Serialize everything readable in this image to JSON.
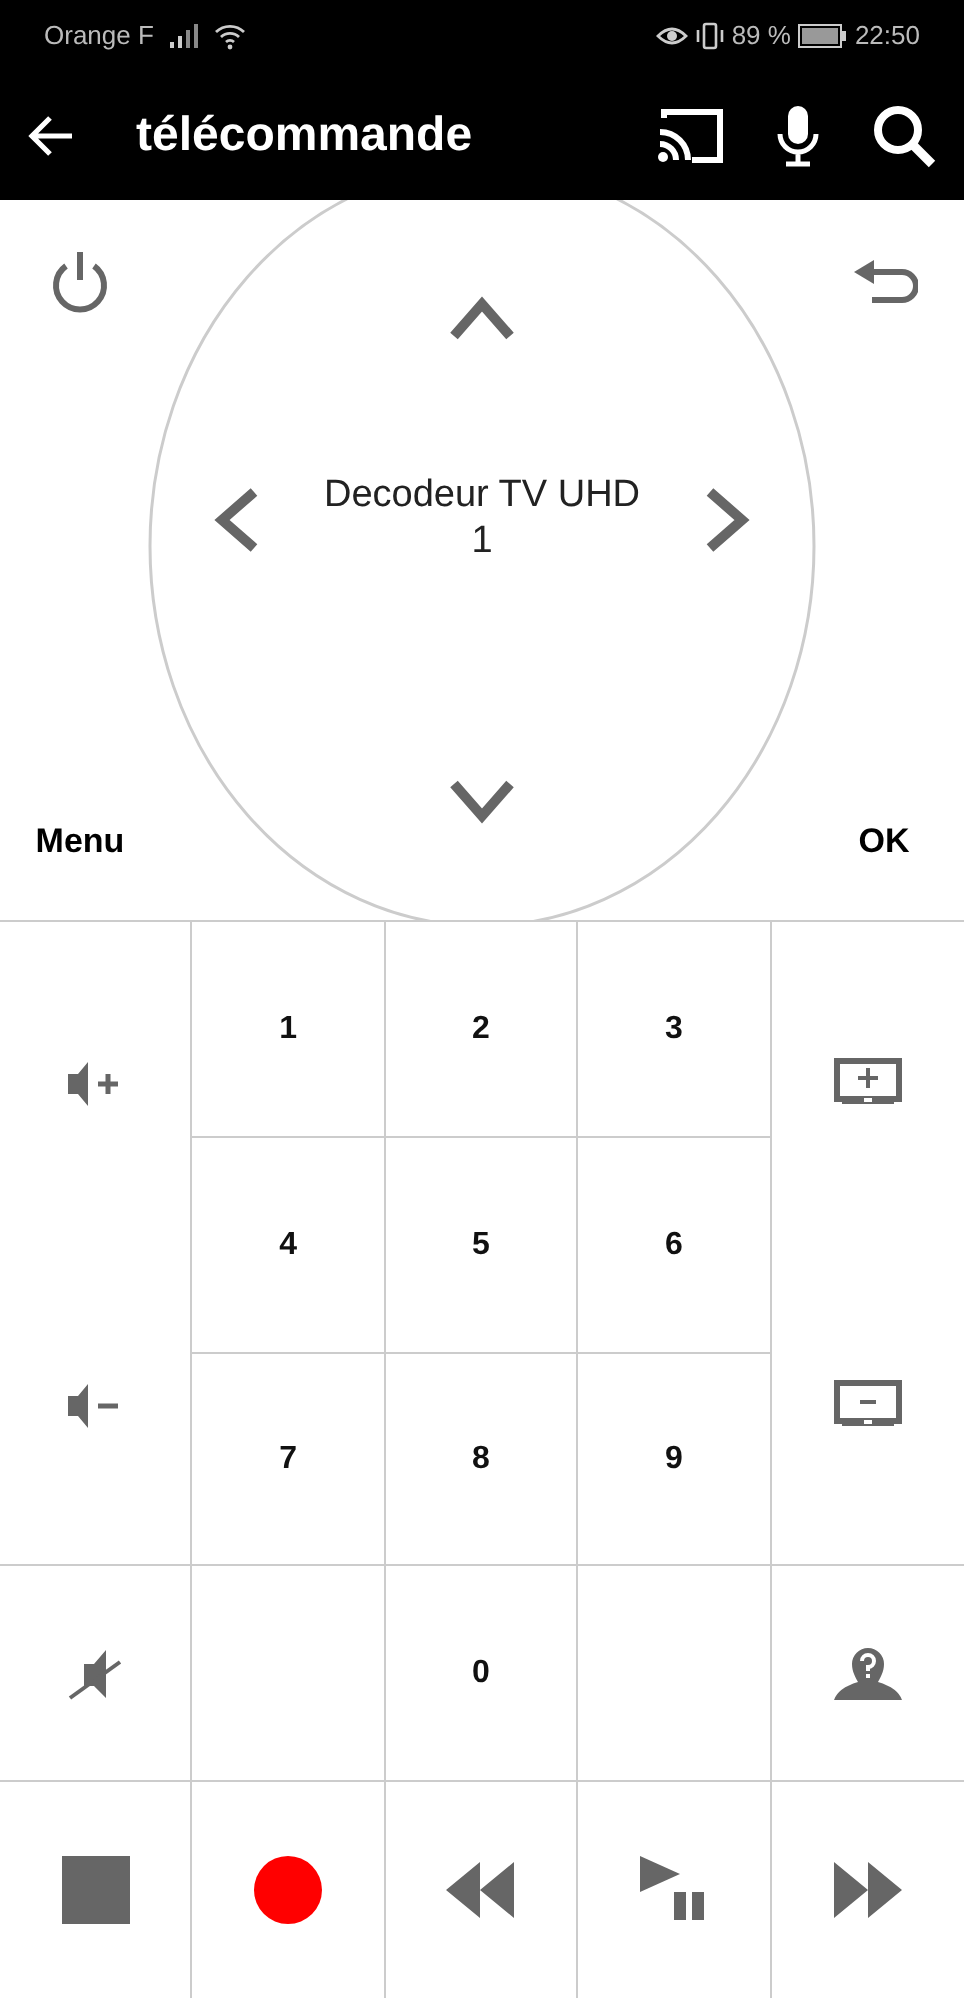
{
  "status_bar": {
    "carrier": "Orange F",
    "battery": "89 %",
    "time": "22:50"
  },
  "app_bar": {
    "title": "télécommande"
  },
  "remote": {
    "device": "Decodeur TV UHD 1",
    "menu_label": "Menu",
    "ok_label": "OK"
  },
  "keypad": {
    "digits": [
      "1",
      "2",
      "3",
      "4",
      "5",
      "6",
      "7",
      "8",
      "9"
    ],
    "zero": "0"
  }
}
